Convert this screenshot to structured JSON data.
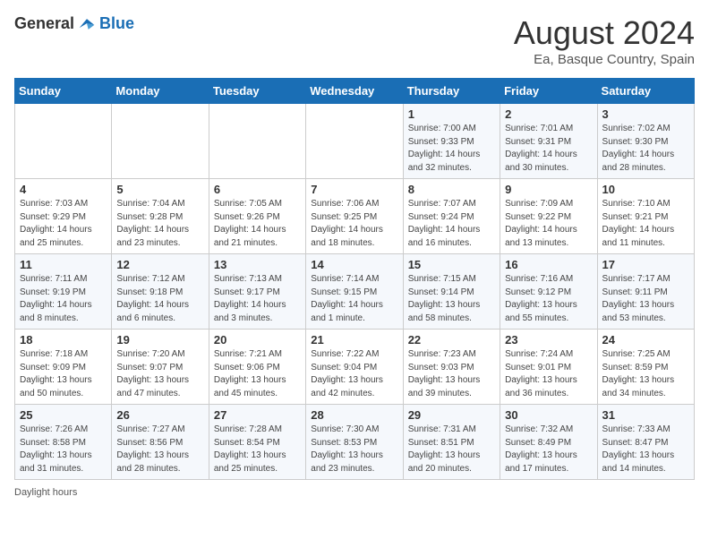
{
  "header": {
    "logo_general": "General",
    "logo_blue": "Blue",
    "month_title": "August 2024",
    "subtitle": "Ea, Basque Country, Spain"
  },
  "weekdays": [
    "Sunday",
    "Monday",
    "Tuesday",
    "Wednesday",
    "Thursday",
    "Friday",
    "Saturday"
  ],
  "weeks": [
    [
      {
        "day": "",
        "info": ""
      },
      {
        "day": "",
        "info": ""
      },
      {
        "day": "",
        "info": ""
      },
      {
        "day": "",
        "info": ""
      },
      {
        "day": "1",
        "info": "Sunrise: 7:00 AM\nSunset: 9:33 PM\nDaylight: 14 hours\nand 32 minutes."
      },
      {
        "day": "2",
        "info": "Sunrise: 7:01 AM\nSunset: 9:31 PM\nDaylight: 14 hours\nand 30 minutes."
      },
      {
        "day": "3",
        "info": "Sunrise: 7:02 AM\nSunset: 9:30 PM\nDaylight: 14 hours\nand 28 minutes."
      }
    ],
    [
      {
        "day": "4",
        "info": "Sunrise: 7:03 AM\nSunset: 9:29 PM\nDaylight: 14 hours\nand 25 minutes."
      },
      {
        "day": "5",
        "info": "Sunrise: 7:04 AM\nSunset: 9:28 PM\nDaylight: 14 hours\nand 23 minutes."
      },
      {
        "day": "6",
        "info": "Sunrise: 7:05 AM\nSunset: 9:26 PM\nDaylight: 14 hours\nand 21 minutes."
      },
      {
        "day": "7",
        "info": "Sunrise: 7:06 AM\nSunset: 9:25 PM\nDaylight: 14 hours\nand 18 minutes."
      },
      {
        "day": "8",
        "info": "Sunrise: 7:07 AM\nSunset: 9:24 PM\nDaylight: 14 hours\nand 16 minutes."
      },
      {
        "day": "9",
        "info": "Sunrise: 7:09 AM\nSunset: 9:22 PM\nDaylight: 14 hours\nand 13 minutes."
      },
      {
        "day": "10",
        "info": "Sunrise: 7:10 AM\nSunset: 9:21 PM\nDaylight: 14 hours\nand 11 minutes."
      }
    ],
    [
      {
        "day": "11",
        "info": "Sunrise: 7:11 AM\nSunset: 9:19 PM\nDaylight: 14 hours\nand 8 minutes."
      },
      {
        "day": "12",
        "info": "Sunrise: 7:12 AM\nSunset: 9:18 PM\nDaylight: 14 hours\nand 6 minutes."
      },
      {
        "day": "13",
        "info": "Sunrise: 7:13 AM\nSunset: 9:17 PM\nDaylight: 14 hours\nand 3 minutes."
      },
      {
        "day": "14",
        "info": "Sunrise: 7:14 AM\nSunset: 9:15 PM\nDaylight: 14 hours\nand 1 minute."
      },
      {
        "day": "15",
        "info": "Sunrise: 7:15 AM\nSunset: 9:14 PM\nDaylight: 13 hours\nand 58 minutes."
      },
      {
        "day": "16",
        "info": "Sunrise: 7:16 AM\nSunset: 9:12 PM\nDaylight: 13 hours\nand 55 minutes."
      },
      {
        "day": "17",
        "info": "Sunrise: 7:17 AM\nSunset: 9:11 PM\nDaylight: 13 hours\nand 53 minutes."
      }
    ],
    [
      {
        "day": "18",
        "info": "Sunrise: 7:18 AM\nSunset: 9:09 PM\nDaylight: 13 hours\nand 50 minutes."
      },
      {
        "day": "19",
        "info": "Sunrise: 7:20 AM\nSunset: 9:07 PM\nDaylight: 13 hours\nand 47 minutes."
      },
      {
        "day": "20",
        "info": "Sunrise: 7:21 AM\nSunset: 9:06 PM\nDaylight: 13 hours\nand 45 minutes."
      },
      {
        "day": "21",
        "info": "Sunrise: 7:22 AM\nSunset: 9:04 PM\nDaylight: 13 hours\nand 42 minutes."
      },
      {
        "day": "22",
        "info": "Sunrise: 7:23 AM\nSunset: 9:03 PM\nDaylight: 13 hours\nand 39 minutes."
      },
      {
        "day": "23",
        "info": "Sunrise: 7:24 AM\nSunset: 9:01 PM\nDaylight: 13 hours\nand 36 minutes."
      },
      {
        "day": "24",
        "info": "Sunrise: 7:25 AM\nSunset: 8:59 PM\nDaylight: 13 hours\nand 34 minutes."
      }
    ],
    [
      {
        "day": "25",
        "info": "Sunrise: 7:26 AM\nSunset: 8:58 PM\nDaylight: 13 hours\nand 31 minutes."
      },
      {
        "day": "26",
        "info": "Sunrise: 7:27 AM\nSunset: 8:56 PM\nDaylight: 13 hours\nand 28 minutes."
      },
      {
        "day": "27",
        "info": "Sunrise: 7:28 AM\nSunset: 8:54 PM\nDaylight: 13 hours\nand 25 minutes."
      },
      {
        "day": "28",
        "info": "Sunrise: 7:30 AM\nSunset: 8:53 PM\nDaylight: 13 hours\nand 23 minutes."
      },
      {
        "day": "29",
        "info": "Sunrise: 7:31 AM\nSunset: 8:51 PM\nDaylight: 13 hours\nand 20 minutes."
      },
      {
        "day": "30",
        "info": "Sunrise: 7:32 AM\nSunset: 8:49 PM\nDaylight: 13 hours\nand 17 minutes."
      },
      {
        "day": "31",
        "info": "Sunrise: 7:33 AM\nSunset: 8:47 PM\nDaylight: 13 hours\nand 14 minutes."
      }
    ]
  ],
  "footer": {
    "daylight_label": "Daylight hours"
  }
}
